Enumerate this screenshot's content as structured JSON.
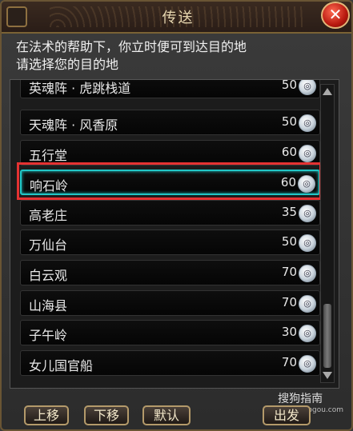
{
  "window": {
    "title": "传送",
    "close_label": "✕",
    "description_line1": "在法术的帮助下，你立时便可到达目的地",
    "description_line2": "请选择您的目的地"
  },
  "destinations": [
    {
      "name": "英魂阵 · 虎跳栈道",
      "cost": "50"
    },
    {
      "name": "天魂阵 · 风香原",
      "cost": "50"
    },
    {
      "name": "五行堂",
      "cost": "60"
    },
    {
      "name": "响石岭",
      "cost": "60",
      "selected": true
    },
    {
      "name": "高老庄",
      "cost": "35"
    },
    {
      "name": "万仙台",
      "cost": "50"
    },
    {
      "name": "白云观",
      "cost": "70"
    },
    {
      "name": "山海县",
      "cost": "70"
    },
    {
      "name": "子午岭",
      "cost": "30"
    },
    {
      "name": "女儿国官船",
      "cost": "70"
    }
  ],
  "buttons": {
    "move_up": "上移",
    "move_down": "下移",
    "default": "默认",
    "depart": "出发"
  },
  "watermark": {
    "text": "搜狗指南",
    "url": "zhinan.sogou.com"
  },
  "colors": {
    "selection_border": "#22c7c7",
    "highlight_box": "#e53232"
  }
}
